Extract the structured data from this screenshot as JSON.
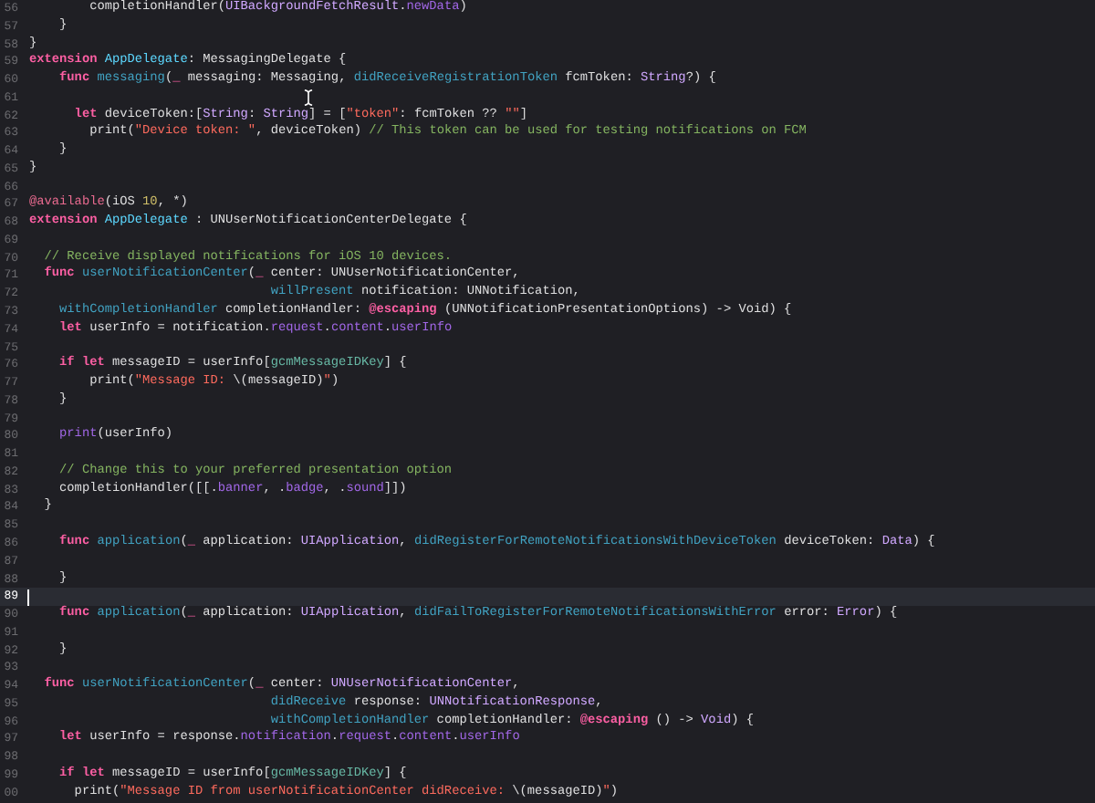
{
  "editor": {
    "lines": [
      {
        "number": "56",
        "current": false,
        "tokens": [
          {
            "kind": "plain",
            "text": "        completionHandler("
          },
          {
            "kind": "type",
            "text": "UIBackgroundFetchResult"
          },
          {
            "kind": "plain",
            "text": "."
          },
          {
            "kind": "property",
            "text": "newData"
          },
          {
            "kind": "plain",
            "text": ")"
          }
        ]
      },
      {
        "number": "57",
        "current": false,
        "tokens": [
          {
            "kind": "plain",
            "text": "    }"
          }
        ]
      },
      {
        "number": "58",
        "current": false,
        "tokens": [
          {
            "kind": "plain",
            "text": "}"
          }
        ]
      },
      {
        "number": "59",
        "current": false,
        "tokens": [
          {
            "kind": "keyword",
            "text": "extension"
          },
          {
            "kind": "type_decl",
            "text": " AppDelegate"
          },
          {
            "kind": "plain",
            "text": ": MessagingDelegate {"
          }
        ]
      },
      {
        "number": "60",
        "current": false,
        "tokens": [
          {
            "kind": "keyword",
            "text": "    func"
          },
          {
            "kind": "func_decl",
            "text": " messaging"
          },
          {
            "kind": "plain",
            "text": "("
          },
          {
            "kind": "keyword",
            "text": "_"
          },
          {
            "kind": "plain",
            "text": " messaging: Messaging, "
          },
          {
            "kind": "func_decl",
            "text": "didReceiveRegistrationToken"
          },
          {
            "kind": "plain",
            "text": " fcmToken: "
          },
          {
            "kind": "type",
            "text": "String"
          },
          {
            "kind": "plain",
            "text": "?) {"
          }
        ]
      },
      {
        "number": "61",
        "current": false
      },
      {
        "number": "62",
        "current": false,
        "tokens": [
          {
            "kind": "keyword",
            "text": "      let"
          },
          {
            "kind": "plain",
            "text": " deviceToken:["
          },
          {
            "kind": "type",
            "text": "String"
          },
          {
            "kind": "plain",
            "text": ": "
          },
          {
            "kind": "type",
            "text": "String"
          },
          {
            "kind": "plain",
            "text": "] = ["
          },
          {
            "kind": "string",
            "text": "\"token\""
          },
          {
            "kind": "plain",
            "text": ": fcmToken ?? "
          },
          {
            "kind": "string",
            "text": "\"\""
          },
          {
            "kind": "plain",
            "text": "]"
          }
        ]
      },
      {
        "number": "63",
        "current": false,
        "tokens": [
          {
            "kind": "plain",
            "text": "        print("
          },
          {
            "kind": "string",
            "text": "\"Device token: \""
          },
          {
            "kind": "plain",
            "text": ", deviceToken) "
          },
          {
            "kind": "comment",
            "text": "// This token can be used for testing notifications on FCM"
          }
        ]
      },
      {
        "number": "64",
        "current": false,
        "tokens": [
          {
            "kind": "plain",
            "text": "    }"
          }
        ]
      },
      {
        "number": "65",
        "current": false,
        "tokens": [
          {
            "kind": "plain",
            "text": "}"
          }
        ]
      },
      {
        "number": "66",
        "current": false
      },
      {
        "number": "67",
        "current": false,
        "tokens": [
          {
            "kind": "attribute",
            "text": "@available"
          },
          {
            "kind": "plain",
            "text": "(iOS "
          },
          {
            "kind": "number",
            "text": "10"
          },
          {
            "kind": "plain",
            "text": ", *)"
          }
        ]
      },
      {
        "number": "68",
        "current": false,
        "tokens": [
          {
            "kind": "keyword",
            "text": "extension"
          },
          {
            "kind": "type_decl",
            "text": " AppDelegate"
          },
          {
            "kind": "plain",
            "text": " : UNUserNotificationCenterDelegate {"
          }
        ]
      },
      {
        "number": "69",
        "current": false
      },
      {
        "number": "70",
        "current": false,
        "tokens": [
          {
            "kind": "comment",
            "text": "  // Receive displayed notifications for iOS 10 devices."
          }
        ]
      },
      {
        "number": "71",
        "current": false,
        "tokens": [
          {
            "kind": "keyword",
            "text": "  func"
          },
          {
            "kind": "func_decl",
            "text": " userNotificationCenter"
          },
          {
            "kind": "plain",
            "text": "("
          },
          {
            "kind": "keyword",
            "text": "_"
          },
          {
            "kind": "plain",
            "text": " center: UNUserNotificationCenter,"
          }
        ]
      },
      {
        "number": "72",
        "current": false,
        "tokens": [
          {
            "kind": "func_decl",
            "text": "                                willPresent"
          },
          {
            "kind": "plain",
            "text": " notification: UNNotification,"
          }
        ]
      },
      {
        "number": "73",
        "current": false,
        "tokens": [
          {
            "kind": "func_decl",
            "text": "    withCompletionHandler"
          },
          {
            "kind": "plain",
            "text": " completionHandler: "
          },
          {
            "kind": "keyword",
            "text": "@escaping"
          },
          {
            "kind": "plain",
            "text": " (UNNotificationPresentationOptions) -> Void) {"
          }
        ]
      },
      {
        "number": "74",
        "current": false,
        "tokens": [
          {
            "kind": "keyword",
            "text": "    let"
          },
          {
            "kind": "plain",
            "text": " userInfo = notification."
          },
          {
            "kind": "property",
            "text": "request"
          },
          {
            "kind": "plain",
            "text": "."
          },
          {
            "kind": "property",
            "text": "content"
          },
          {
            "kind": "plain",
            "text": "."
          },
          {
            "kind": "property",
            "text": "userInfo"
          }
        ]
      },
      {
        "number": "75",
        "current": false
      },
      {
        "number": "76",
        "current": false,
        "tokens": [
          {
            "kind": "keyword",
            "text": "    if let"
          },
          {
            "kind": "plain",
            "text": " messageID = userInfo["
          },
          {
            "kind": "constant",
            "text": "gcmMessageIDKey"
          },
          {
            "kind": "plain",
            "text": "] {"
          }
        ]
      },
      {
        "number": "77",
        "current": false,
        "tokens": [
          {
            "kind": "plain",
            "text": "        print("
          },
          {
            "kind": "string",
            "text": "\"Message ID: "
          },
          {
            "kind": "plain",
            "text": "\\(messageID)"
          },
          {
            "kind": "string",
            "text": "\""
          },
          {
            "kind": "plain",
            "text": ")"
          }
        ]
      },
      {
        "number": "78",
        "current": false,
        "tokens": [
          {
            "kind": "plain",
            "text": "    }"
          }
        ]
      },
      {
        "number": "79",
        "current": false
      },
      {
        "number": "80",
        "current": false,
        "tokens": [
          {
            "kind": "property",
            "text": "    print"
          },
          {
            "kind": "plain",
            "text": "(userInfo)"
          }
        ]
      },
      {
        "number": "81",
        "current": false
      },
      {
        "number": "82",
        "current": false,
        "tokens": [
          {
            "kind": "comment",
            "text": "    // Change this to your preferred presentation option"
          }
        ]
      },
      {
        "number": "83",
        "current": false,
        "tokens": [
          {
            "kind": "plain",
            "text": "    completionHandler([[."
          },
          {
            "kind": "property",
            "text": "banner"
          },
          {
            "kind": "plain",
            "text": ", ."
          },
          {
            "kind": "property",
            "text": "badge"
          },
          {
            "kind": "plain",
            "text": ", ."
          },
          {
            "kind": "property",
            "text": "sound"
          },
          {
            "kind": "plain",
            "text": "]])"
          }
        ]
      },
      {
        "number": "84",
        "current": false,
        "tokens": [
          {
            "kind": "plain",
            "text": "  }"
          }
        ]
      },
      {
        "number": "85",
        "current": false
      },
      {
        "number": "86",
        "current": false,
        "tokens": [
          {
            "kind": "keyword",
            "text": "    func"
          },
          {
            "kind": "func_decl",
            "text": " application"
          },
          {
            "kind": "plain",
            "text": "("
          },
          {
            "kind": "keyword",
            "text": "_"
          },
          {
            "kind": "plain",
            "text": " application: "
          },
          {
            "kind": "type",
            "text": "UIApplication"
          },
          {
            "kind": "plain",
            "text": ", "
          },
          {
            "kind": "func_decl",
            "text": "didRegisterForRemoteNotificationsWithDeviceToken"
          },
          {
            "kind": "plain",
            "text": " deviceToken: "
          },
          {
            "kind": "type",
            "text": "Data"
          },
          {
            "kind": "plain",
            "text": ") {"
          }
        ]
      },
      {
        "number": "87",
        "current": false
      },
      {
        "number": "88",
        "current": false,
        "tokens": [
          {
            "kind": "plain",
            "text": "    }"
          }
        ]
      },
      {
        "number": "89",
        "current": true
      },
      {
        "number": "90",
        "current": false,
        "tokens": [
          {
            "kind": "keyword",
            "text": "    func"
          },
          {
            "kind": "func_decl",
            "text": " application"
          },
          {
            "kind": "plain",
            "text": "("
          },
          {
            "kind": "keyword",
            "text": "_"
          },
          {
            "kind": "plain",
            "text": " application: "
          },
          {
            "kind": "type",
            "text": "UIApplication"
          },
          {
            "kind": "plain",
            "text": ", "
          },
          {
            "kind": "func_decl",
            "text": "didFailToRegisterForRemoteNotificationsWithError"
          },
          {
            "kind": "plain",
            "text": " error: "
          },
          {
            "kind": "type",
            "text": "Error"
          },
          {
            "kind": "plain",
            "text": ") {"
          }
        ]
      },
      {
        "number": "91",
        "current": false
      },
      {
        "number": "92",
        "current": false,
        "tokens": [
          {
            "kind": "plain",
            "text": "    }"
          }
        ]
      },
      {
        "number": "93",
        "current": false
      },
      {
        "number": "94",
        "current": false,
        "tokens": [
          {
            "kind": "keyword",
            "text": "  func"
          },
          {
            "kind": "func_decl",
            "text": " userNotificationCenter"
          },
          {
            "kind": "plain",
            "text": "("
          },
          {
            "kind": "keyword",
            "text": "_"
          },
          {
            "kind": "plain",
            "text": " center: "
          },
          {
            "kind": "type",
            "text": "UNUserNotificationCenter"
          },
          {
            "kind": "plain",
            "text": ","
          }
        ]
      },
      {
        "number": "95",
        "current": false,
        "tokens": [
          {
            "kind": "func_decl",
            "text": "                                didReceive"
          },
          {
            "kind": "plain",
            "text": " response: "
          },
          {
            "kind": "type",
            "text": "UNNotificationResponse"
          },
          {
            "kind": "plain",
            "text": ","
          }
        ]
      },
      {
        "number": "96",
        "current": false,
        "tokens": [
          {
            "kind": "func_decl",
            "text": "                                withCompletionHandler"
          },
          {
            "kind": "plain",
            "text": " completionHandler: "
          },
          {
            "kind": "keyword",
            "text": "@escaping"
          },
          {
            "kind": "plain",
            "text": " () -> "
          },
          {
            "kind": "type",
            "text": "Void"
          },
          {
            "kind": "plain",
            "text": ") {"
          }
        ]
      },
      {
        "number": "97",
        "current": false,
        "tokens": [
          {
            "kind": "keyword",
            "text": "    let"
          },
          {
            "kind": "plain",
            "text": " userInfo = response."
          },
          {
            "kind": "property",
            "text": "notification"
          },
          {
            "kind": "plain",
            "text": "."
          },
          {
            "kind": "property",
            "text": "request"
          },
          {
            "kind": "plain",
            "text": "."
          },
          {
            "kind": "property",
            "text": "content"
          },
          {
            "kind": "plain",
            "text": "."
          },
          {
            "kind": "property",
            "text": "userInfo"
          }
        ]
      },
      {
        "number": "98",
        "current": false
      },
      {
        "number": "99",
        "current": false,
        "tokens": [
          {
            "kind": "keyword",
            "text": "    if let"
          },
          {
            "kind": "plain",
            "text": " messageID = userInfo["
          },
          {
            "kind": "constant",
            "text": "gcmMessageIDKey"
          },
          {
            "kind": "plain",
            "text": "] {"
          }
        ]
      },
      {
        "number": "00",
        "current": false,
        "tokens": [
          {
            "kind": "plain",
            "text": "      print("
          },
          {
            "kind": "string",
            "text": "\"Message ID from userNotificationCenter didReceive: "
          },
          {
            "kind": "plain",
            "text": "\\(messageID)"
          },
          {
            "kind": "string",
            "text": "\""
          },
          {
            "kind": "plain",
            "text": ")"
          }
        ]
      }
    ]
  }
}
